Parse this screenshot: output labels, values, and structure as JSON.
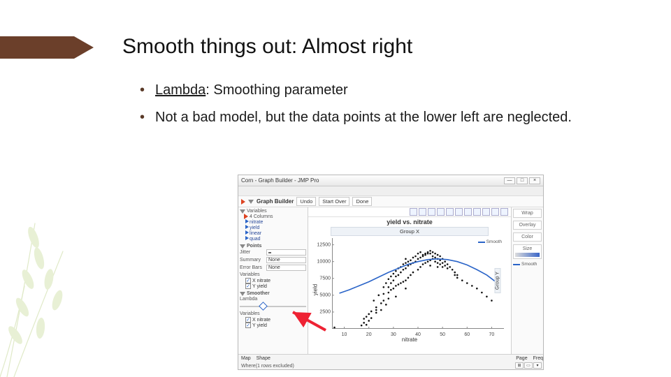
{
  "slide": {
    "title": "Smooth things out: Almost right",
    "bullets": [
      {
        "pre": "",
        "u": "Lambda",
        "post": ": Smoothing parameter"
      },
      {
        "pre": "Not a bad model, but the data points at the lower left are neglected.",
        "u": "",
        "post": ""
      }
    ]
  },
  "app": {
    "window_title": "Corn - Graph Builder - JMP Pro",
    "window_controls": {
      "min": "—",
      "max": "□",
      "close": "×"
    },
    "panel_header": "Graph Builder",
    "head_buttons": [
      "Undo",
      "Start Over",
      "Done"
    ],
    "leftpane": {
      "variables_label": "Variables",
      "columns_label": "4 Columns",
      "columns": [
        "nitrate",
        "yield",
        "linear",
        "quad"
      ],
      "points_label": "Points",
      "points_rows": [
        {
          "label": "Jitter",
          "value": ""
        },
        {
          "label": "Summary",
          "value": "None"
        },
        {
          "label": "Error Bars",
          "value": "None"
        },
        {
          "label": "Variables",
          "value": ""
        }
      ],
      "points_checks": [
        {
          "label": "X  nitrate",
          "checked": true
        },
        {
          "label": "Y  yield",
          "checked": true
        }
      ],
      "smoother_label": "Smoother",
      "lambda_label": "Lambda",
      "lambda_pos_pct": 30,
      "smoother_variables_label": "Variables",
      "smoother_checks": [
        {
          "label": "X  nitrate",
          "checked": true
        },
        {
          "label": "Y  yield",
          "checked": true
        }
      ]
    },
    "rightpane": {
      "wrap": "Wrap",
      "overlay": "Overlay",
      "color": "Color",
      "size": "Size",
      "legend": "Smooth",
      "groupy": "Group Y"
    },
    "plot": {
      "title": "yield vs. nitrate",
      "group_x": "Group X",
      "xlabel": "nitrate",
      "ylabel": "yield",
      "x_ticks": [
        10,
        20,
        30,
        40,
        50,
        60,
        70
      ],
      "y_ticks": [
        2500,
        5000,
        7500,
        10000,
        12500
      ]
    },
    "footer": {
      "map_label": "Map",
      "shape_label": "Shape",
      "page_label": "Page",
      "freq_label": "Freq",
      "where_text": "Where(1 rows excluded)"
    }
  },
  "chart_data": {
    "type": "scatter",
    "title": "yield vs. nitrate",
    "xlabel": "nitrate",
    "ylabel": "yield",
    "xlim": [
      5,
      75
    ],
    "ylim": [
      0,
      13500
    ],
    "series": [
      {
        "name": "points",
        "kind": "scatter",
        "x": [
          6,
          17,
          18,
          18,
          19,
          19,
          20,
          20,
          21,
          21,
          22,
          23,
          23,
          23,
          24,
          25,
          25,
          26,
          26,
          26,
          27,
          27,
          28,
          28,
          28,
          28,
          29,
          29,
          29,
          30,
          30,
          30,
          31,
          31,
          31,
          31,
          32,
          32,
          32,
          33,
          33,
          33,
          34,
          34,
          34,
          35,
          35,
          35,
          35,
          35,
          36,
          36,
          36,
          37,
          37,
          37,
          38,
          38,
          38,
          39,
          39,
          40,
          40,
          40,
          41,
          41,
          41,
          42,
          42,
          42,
          43,
          43,
          43,
          44,
          44,
          44,
          45,
          45,
          45,
          45,
          46,
          46,
          46,
          47,
          47,
          47,
          48,
          48,
          48,
          48,
          49,
          49,
          49,
          50,
          50,
          50,
          51,
          51,
          52,
          52,
          53,
          54,
          55,
          55,
          56,
          56,
          58,
          60,
          62,
          64,
          66,
          68,
          70
        ],
        "y": [
          200,
          500,
          900,
          1500,
          1800,
          600,
          2200,
          1200,
          2600,
          1600,
          4200,
          2800,
          3200,
          2400,
          5000,
          3800,
          2800,
          6200,
          5200,
          4200,
          6800,
          3600,
          7400,
          6200,
          5400,
          4500,
          7800,
          6800,
          5800,
          8200,
          7200,
          6000,
          8600,
          7800,
          6400,
          4800,
          9000,
          8000,
          6600,
          9200,
          8400,
          6800,
          9600,
          8800,
          7000,
          9800,
          9000,
          7200,
          6000,
          10400,
          10000,
          9400,
          7600,
          10200,
          9600,
          8000,
          10600,
          9800,
          8400,
          10800,
          10000,
          11200,
          10400,
          8800,
          11400,
          10600,
          9200,
          11000,
          10800,
          9600,
          11200,
          11000,
          9800,
          11400,
          11200,
          10000,
          11600,
          11200,
          10200,
          9400,
          11400,
          10800,
          10400,
          11200,
          10600,
          10000,
          11000,
          10400,
          9800,
          9200,
          10800,
          10200,
          9600,
          10400,
          9800,
          9200,
          10000,
          9400,
          9600,
          9000,
          9200,
          8800,
          8400,
          8000,
          8000,
          7600,
          7200,
          6800,
          6400,
          6000,
          5400,
          4800,
          4200
        ]
      },
      {
        "name": "Smooth",
        "kind": "line",
        "x": [
          8,
          12,
          16,
          20,
          24,
          28,
          32,
          36,
          40,
          44,
          48,
          52,
          56,
          60,
          64,
          68,
          72
        ],
        "y": [
          5300,
          5800,
          6400,
          7000,
          7700,
          8400,
          9000,
          9600,
          10000,
          10300,
          10400,
          10300,
          10000,
          9500,
          8800,
          8000,
          6900
        ]
      }
    ]
  }
}
